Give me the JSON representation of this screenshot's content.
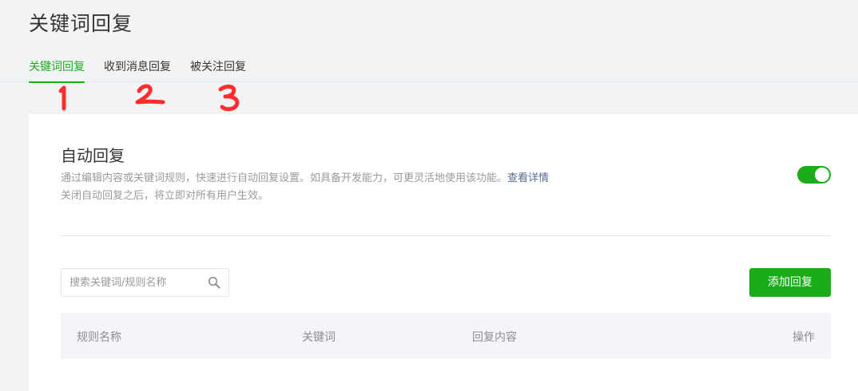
{
  "page": {
    "title": "关键词回复"
  },
  "tabs": [
    {
      "label": "关键词回复",
      "active": true
    },
    {
      "label": "收到消息回复",
      "active": false
    },
    {
      "label": "被关注回复",
      "active": false
    }
  ],
  "auto_reply": {
    "title": "自动回复",
    "desc_line1": "通过编辑内容或关键词规则，快速进行自动回复设置。如具备开发能力，可更灵活地使用该功能。",
    "desc_link": "查看详情",
    "desc_line2": "关闭自动回复之后，将立即对所有用户生效。",
    "enabled": true
  },
  "search": {
    "placeholder": "搜索关键词/规则名称",
    "value": ""
  },
  "add_button": {
    "label": "添加回复"
  },
  "table": {
    "columns": [
      "规则名称",
      "关键词",
      "回复内容",
      "操作"
    ]
  },
  "colors": {
    "accent": "#1aad19",
    "link": "#576b95",
    "annotation": "#ff2d2d"
  }
}
